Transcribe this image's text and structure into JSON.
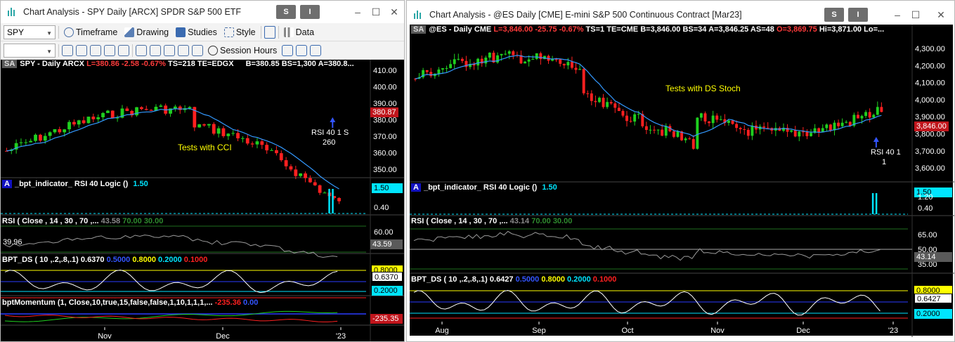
{
  "left": {
    "title": "Chart Analysis - SPY Daily [ARCX] SPDR S&P 500 ETF",
    "menu1": "S",
    "menu2": "I",
    "symbol_value": "SPY",
    "toolbar1": [
      "Timeframe",
      "Drawing",
      "Studies",
      "Style",
      "Data"
    ],
    "session_label": "Session Hours",
    "header": {
      "sa": "SA",
      "sym": "SPY - Daily",
      "exch": "ARCX",
      "l": "L=380.86",
      "chg": "-2.58",
      "pct": "-0.67%",
      "ts": "TS=218",
      "te": "TE=EDGX",
      "b": "B=380.85",
      "bs": "BS=1,300",
      "a": "A=380.8..."
    },
    "price_ticks": [
      "410.00",
      "400.00",
      "390.00",
      "380.00",
      "370.00",
      "360.00",
      "350.00"
    ],
    "last_price": "380.87",
    "annotation": "Tests with CCI",
    "signal_line1": "RSI 40 1 S",
    "signal_line2": "260",
    "ind1_badge": "A",
    "ind1_name": "_bpt_indicator_ RSI 40 Logic ()",
    "ind1_val": "1.50",
    "ind1_tag": "1.50",
    "ind1_tick": "0.40",
    "rsi_name": "RSI ( Close , 14 , 30 , 70 ,...",
    "rsi_v1": "43.58",
    "rsi_v2": "70.00",
    "rsi_v3": "30.00",
    "rsi_tick": "60.00",
    "rsi_left": "39.96",
    "rsi_tag": "43.59",
    "ds_name": "BPT_DS ( 10 ,.2,.8,.1)",
    "ds_v": "0.6370",
    "ds_v2": "0.5000",
    "ds_v3": "0.8000",
    "ds_v4": "0.2000",
    "ds_v5": "0.1000",
    "ds_tag1": "0.8000",
    "ds_tag2": "0.6370",
    "ds_tag3": "0.2000",
    "mom_name": "bptMomentum (1, Close,10,true,15,false,false,1,10,1,1,1,...",
    "mom_v1": "-235.36",
    "mom_v2": "0.00",
    "mom_tag": "-235.35",
    "months": [
      "Nov",
      "Dec",
      "'23"
    ]
  },
  "right": {
    "title": "Chart Analysis - @ES Daily [CME] E-mini S&P 500 Continuous Contract [Mar23]",
    "menu1": "S",
    "menu2": "I",
    "header": {
      "sa": "SA",
      "sym": "@ES - Daily",
      "exch": "CME",
      "l": "L=3,846.00",
      "chg": "-25.75",
      "pct": "-0.67%",
      "ts": "TS=1",
      "te": "TE=CME",
      "b": "B=3,846.00",
      "bs": "BS=34",
      "a": "A=3,846.25",
      "as": "AS=48",
      "o": "O=3,869.75",
      "hi": "Hi=3,871.00",
      "lo": "Lo=..."
    },
    "price_ticks": [
      "4,300.00",
      "4,200.00",
      "4,100.00",
      "4,000.00",
      "3,900.00",
      "3,800.00",
      "3,700.00",
      "3,600.00"
    ],
    "last_price": "3,846.00",
    "annotation": "Tests with DS Stoch",
    "signal_line1": "RSI 40 1",
    "signal_line2": "1",
    "ind1_badge": "A",
    "ind1_name": "_bpt_indicator_ RSI 40 Logic ()",
    "ind1_val": "1.50",
    "ind1_tag": "1.50",
    "ind1_tick1": "1.20",
    "ind1_tick2": "0.40",
    "rsi_name": "RSI ( Close , 14 , 30 , 70 ,...",
    "rsi_v1": "43.14",
    "rsi_v2": "70.00",
    "rsi_v3": "30.00",
    "rsi_ticks": [
      "65.00",
      "50.00",
      "35.00"
    ],
    "rsi_tag": "43.14",
    "ds_name": "BPT_DS ( 10 ,.2,.8,.1)",
    "ds_v": "0.6427",
    "ds_v2": "0.5000",
    "ds_v3": "0.8000",
    "ds_v4": "0.2000",
    "ds_v5": "0.1000",
    "ds_tag1": "0.8000",
    "ds_tag2": "0.6427",
    "ds_tag3": "0.2000",
    "months": [
      "Aug",
      "Sep",
      "Oct",
      "Nov",
      "Dec",
      "'23"
    ]
  },
  "colors": {
    "up": "#1fd01f",
    "down": "#ff2020",
    "ma": "#3399ff",
    "bg": "#000000",
    "ds_upper": "#ffff00",
    "ds_lower": "#ff2020",
    "ds_mid": "#2b3cff",
    "ds_02": "#00e5ff"
  }
}
